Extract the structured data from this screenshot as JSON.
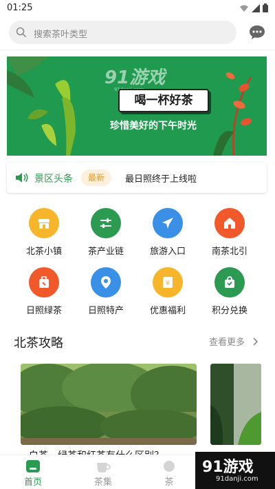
{
  "status_bar": {
    "time": "01:25"
  },
  "search": {
    "placeholder": "搜索茶叶类型"
  },
  "banner": {
    "logo": "91游戏",
    "logo_sub": "91danji.com",
    "headline": "喝一杯好茶",
    "subtitle": "珍惜美好的下午时光"
  },
  "news": {
    "title": "景区头条",
    "badge": "最新",
    "text": "最日照终于上线啦"
  },
  "grid": [
    {
      "label": "北茶小镇",
      "color": "#f7b52c",
      "icon": "store-icon"
    },
    {
      "label": "茶产业链",
      "color": "#2d9a52",
      "icon": "sliders-icon"
    },
    {
      "label": "旅游入口",
      "color": "#3a8fe6",
      "icon": "plane-icon"
    },
    {
      "label": "南茶北引",
      "color": "#f2592a",
      "icon": "house-icon"
    },
    {
      "label": "日照绿茶",
      "color": "#f2592a",
      "icon": "tea-bag-icon"
    },
    {
      "label": "日照特产",
      "color": "#3a8fe6",
      "icon": "location-pin-icon"
    },
    {
      "label": "优惠福利",
      "color": "#f7b52c",
      "icon": "coupon-icon"
    },
    {
      "label": "积分兑换",
      "color": "#2d9a52",
      "icon": "shopping-bag-icon"
    }
  ],
  "section": {
    "title": "北茶攻略",
    "more": "查看更多"
  },
  "cards": [
    {
      "title": "白茶、绿茶和红茶有什么区别？"
    }
  ],
  "tabs": [
    {
      "label": "首页",
      "active": true
    },
    {
      "label": "茶集",
      "active": false
    },
    {
      "label": "茶",
      "active": false
    }
  ],
  "watermark": {
    "main": "91游戏",
    "sub": "91danji.com"
  },
  "colors": {
    "accent": "#2d9a52",
    "banner": "#1f9a4e",
    "badge_text": "#e39a2c"
  }
}
